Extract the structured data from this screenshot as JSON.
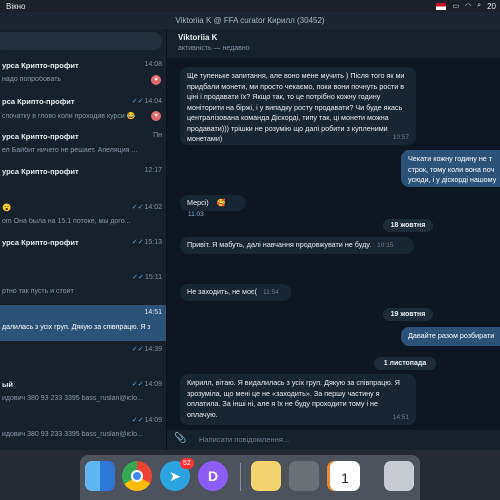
{
  "menubar": {
    "menu_item": "Вікно",
    "clock": "20"
  },
  "window_title": "Viktoriia K @ FFA curator Кирилл (30452)",
  "sidebar": {
    "chats": [
      {
        "name": "урса Крипто-профит",
        "time": "14:08",
        "preview": "надо попробовать",
        "ticks": "",
        "heart": true
      },
      {
        "name": "рса Крипто-профит",
        "time": "14:04",
        "preview": "спочатку в глово коли проходив курси 😂",
        "ticks": "✓✓",
        "heart": true
      },
      {
        "name": "урса Крипто-профит",
        "time": "Пн",
        "preview": "ел Байбит ничего не решает. Апеляция ...",
        "ticks": "",
        "heart": false
      },
      {
        "name": "урса Крипто-профит",
        "time": "12:17",
        "preview": "",
        "ticks": "",
        "heart": false
      },
      {
        "name": "😮",
        "time": "14:02",
        "preview": "om Она была на 15.1 потоке, мы дого...",
        "ticks": "✓✓",
        "heart": false
      },
      {
        "name": "урса Крипто-профит",
        "time": "15:13",
        "preview": "",
        "ticks": "✓✓",
        "heart": false
      },
      {
        "name": "",
        "time": "15:11",
        "preview": "ртно так пусть и стоит",
        "ticks": "✓✓",
        "heart": false
      },
      {
        "name": "",
        "time": "14:51",
        "preview": "далилась з усіх груп. Дякую за співпрацю. Я з...",
        "ticks": "",
        "heart": false,
        "selected": true
      },
      {
        "name": "",
        "time": "14:39",
        "preview": "",
        "ticks": "✓✓",
        "heart": false
      },
      {
        "name": "ый",
        "time": "14:09",
        "preview": "идович    380 93 233 3395    bass_ruslan@iclo...",
        "ticks": "✓✓",
        "heart": false
      },
      {
        "name": "",
        "time": "14:09",
        "preview": "идович    380 93 233 3395    bass_ruslan@iclo...",
        "ticks": "✓✓",
        "heart": false
      },
      {
        "name": "",
        "time": "14:05",
        "preview": "",
        "ticks": "✓✓",
        "heart": false
      }
    ]
  },
  "chat": {
    "title": "Viktoriia K",
    "status": "активність — недавно",
    "messages": {
      "m1": "Ще тупеньке запитання, але воно мене мучить ) Після того як ми придбали монети, ми просто чекаємо, поки вони почнуть рости в ціні і продавати їх? Якщо так, то це потрібно кожну годину моніторити на біржі, і у випадку росту продавати? Чи буде якась централізована команда Діскорді, типу так, ці монети можна продавати))) трішки не розумію що далі робити з купленими монетами)",
      "m1_time": "10:57",
      "m2": "Чекати кожну годину не т строк, тому коли вона поч усюди, і у діскорді нашому",
      "m3": "Мерсі)",
      "m3_emoji": "🥰",
      "m3_time": "11:03",
      "d1": "18 жовтня",
      "m4": "Привіт. Я мабуть, далі навчання продовжувати не буду.",
      "m4_time": "10:15",
      "m5": "Не заходить, не моє(",
      "m5_time": "11:54",
      "d2": "19 жовтня",
      "m6": "Давайте разом розбирати",
      "d3": "1 листопада",
      "m7": "Кирилл, вітаю. Я видалилась з усіх груп. Дякую за співпрацю. Я зрозуміла, що мені це не «заходить». За першу частину я оплатила. За інші ні, але я їх не буду проходити тому і не оплачую.",
      "m7_time": "14:51"
    },
    "input_placeholder": "Написати повідомлення..."
  },
  "dock": {
    "telegram_badge": "52",
    "calendar_day": "1"
  }
}
